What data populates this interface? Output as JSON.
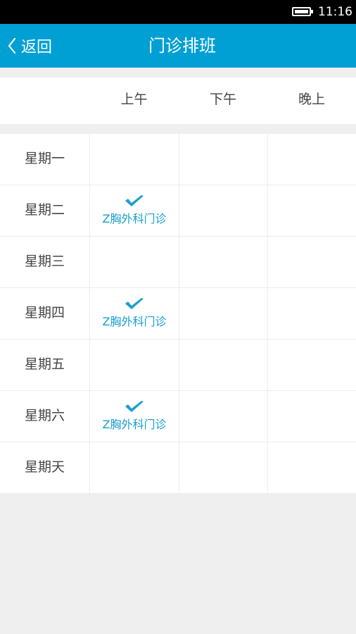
{
  "status_bar": {
    "time": "11:16",
    "battery_icon": "battery-icon"
  },
  "nav": {
    "back_label": "返回",
    "back_icon": "chevron-left-icon",
    "title": "门诊排班"
  },
  "colors": {
    "accent": "#009fd4",
    "appointment_text": "#1a9fd0",
    "background": "#efefef"
  },
  "columns": [
    "上午",
    "下午",
    "晚上"
  ],
  "days": [
    {
      "label": "星期一",
      "slots": [
        "",
        "",
        ""
      ]
    },
    {
      "label": "星期二",
      "slots": [
        "Z胸外科门诊",
        "",
        ""
      ]
    },
    {
      "label": "星期三",
      "slots": [
        "",
        "",
        ""
      ]
    },
    {
      "label": "星期四",
      "slots": [
        "Z胸外科门诊",
        "",
        ""
      ]
    },
    {
      "label": "星期五",
      "slots": [
        "",
        "",
        ""
      ]
    },
    {
      "label": "星期六",
      "slots": [
        "Z胸外科门诊",
        "",
        ""
      ]
    },
    {
      "label": "星期天",
      "slots": [
        "",
        "",
        ""
      ]
    }
  ],
  "appointment_icon": "checkmark-icon"
}
